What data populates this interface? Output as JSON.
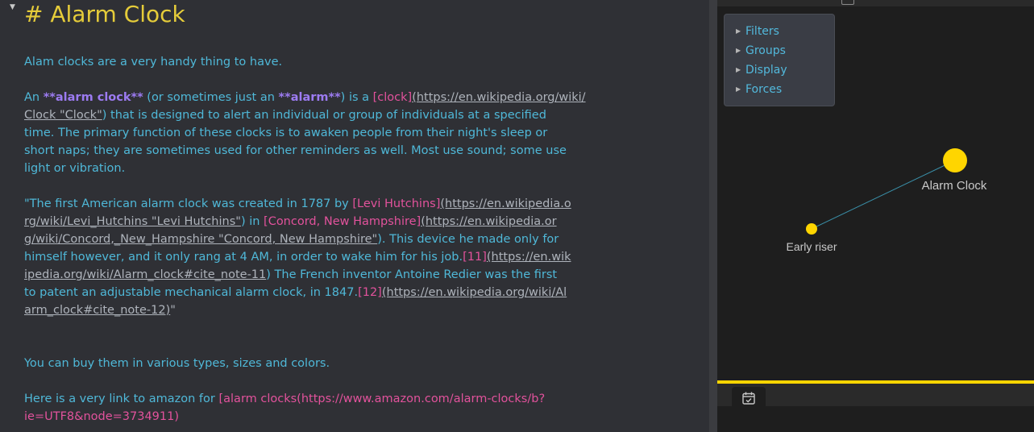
{
  "editor": {
    "heading": "# Alarm Clock",
    "p1": "Alam clocks are a very handy thing to have.",
    "p2": {
      "l1a": "An ",
      "l1b": "**alarm clock**",
      "l1c": " (or sometimes just an ",
      "l1d": "**alarm**",
      "l1e": ") is a ",
      "l1f": "[clock]",
      "l1g": "(https://en.wikipedia.org/wiki/",
      "l2a": "Clock \"Clock\"",
      "l2b": ") that is designed to alert an individual or group of individuals at a specified",
      "l3": "time. The primary function of these clocks is to awaken people from their night's sleep or",
      "l4": "short naps; they are sometimes used for other reminders as well. Most use sound; some use",
      "l5": "light or vibration."
    },
    "p3": {
      "l1a": "\"The first American alarm clock was created in 1787 by ",
      "l1b": "[Levi Hutchins]",
      "l1c": "(https://en.wikipedia.o",
      "l2a": "rg/wiki/Levi_Hutchins \"Levi Hutchins\"",
      "l2b": ") in ",
      "l2c": "[Concord, New Hampshire]",
      "l2d": "(https://en.wikipedia.or",
      "l3a": "g/wiki/Concord,_New_Hampshire \"Concord, New Hampshire\"",
      "l3b": "). This device he made only for",
      "l4a": "himself however, and it only rang at 4 AM, in order to wake him for his job.",
      "l4b": "[11]",
      "l4c": "(https://en.wik",
      "l5a": "ipedia.org/wiki/Alarm_clock#cite_note-11",
      "l5b": ") The French inventor Antoine Redier was the first",
      "l6a": "to patent an adjustable mechanical alarm clock, in 1847.",
      "l6b": "[12]",
      "l6c": "(https://en.wikipedia.org/wiki/Al",
      "l7a": "arm_clock#cite_note-12)",
      "l7b": "\""
    },
    "p4": "You can buy them in various types, sizes and colors.",
    "p5": {
      "l1a": "Here is a very link to amazon for ",
      "l1b": "[alarm clocks(https://www.amazon.com/alarm-clocks/b?",
      "l2": "ie=UTF8&node=3734911)"
    }
  },
  "graph": {
    "controls": [
      "Filters",
      "Groups",
      "Display",
      "Forces"
    ],
    "nodes": [
      {
        "label": "Alarm Clock"
      },
      {
        "label": "Early riser"
      }
    ],
    "colors": {
      "node": "#ffd500",
      "link": "#3a8fa8",
      "label": "#c9c9c9"
    }
  },
  "bottom": {
    "tab_icon": "calendar-check-icon"
  }
}
